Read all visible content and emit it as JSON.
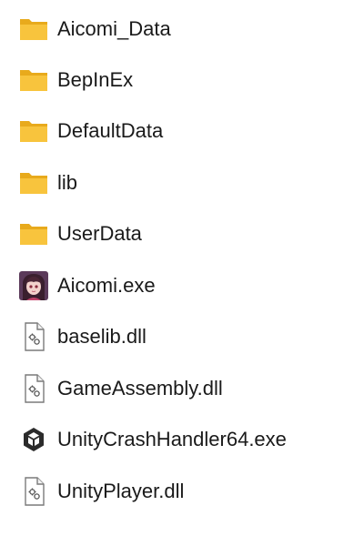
{
  "items": [
    {
      "name": "Aicomi_Data",
      "icon": "folder-icon"
    },
    {
      "name": "BepInEx",
      "icon": "folder-icon"
    },
    {
      "name": "DefaultData",
      "icon": "folder-icon"
    },
    {
      "name": "lib",
      "icon": "folder-icon"
    },
    {
      "name": "UserData",
      "icon": "folder-icon"
    },
    {
      "name": "Aicomi.exe",
      "icon": "app-character-icon"
    },
    {
      "name": "baselib.dll",
      "icon": "dll-file-icon"
    },
    {
      "name": "GameAssembly.dll",
      "icon": "dll-file-icon"
    },
    {
      "name": "UnityCrashHandler64.exe",
      "icon": "unity-logo-icon"
    },
    {
      "name": "UnityPlayer.dll",
      "icon": "dll-file-icon"
    }
  ],
  "colors": {
    "folder": "#f8c43d",
    "folder_tab": "#e8aa1c",
    "text": "#1a1a1a"
  }
}
